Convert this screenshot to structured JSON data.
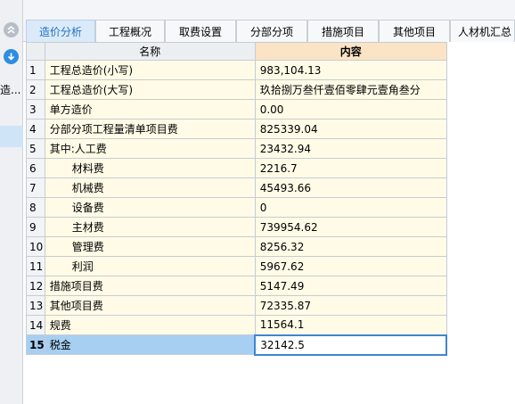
{
  "tabs": [
    {
      "label": "造价分析",
      "active": true
    },
    {
      "label": "工程概况",
      "active": false
    },
    {
      "label": "取费设置",
      "active": false
    },
    {
      "label": "分部分项",
      "active": false
    },
    {
      "label": "措施项目",
      "active": false
    },
    {
      "label": "其他项目",
      "active": false
    },
    {
      "label": "人材机汇总",
      "active": false
    }
  ],
  "rail": {
    "truncated_text": "造..."
  },
  "table": {
    "headers": {
      "name": "名称",
      "content": "内容"
    },
    "rows": [
      {
        "no": "1",
        "name": "工程总造价(小写)",
        "value": "983,104.13"
      },
      {
        "no": "2",
        "name": "工程总造价(大写)",
        "value": "玖拾捌万叁仟壹佰零肆元壹角叁分"
      },
      {
        "no": "3",
        "name": "单方造价",
        "value": "0.00"
      },
      {
        "no": "4",
        "name": "分部分项工程量清单项目费",
        "value": "825339.04"
      },
      {
        "no": "5",
        "name": "其中:人工费",
        "value": "23432.94"
      },
      {
        "no": "6",
        "name": "材料费",
        "value": "2216.7",
        "indent": true
      },
      {
        "no": "7",
        "name": "机械费",
        "value": "45493.66",
        "indent": true
      },
      {
        "no": "8",
        "name": "设备费",
        "value": "0",
        "indent": true
      },
      {
        "no": "9",
        "name": "主材费",
        "value": "739954.62",
        "indent": true
      },
      {
        "no": "10",
        "name": "管理费",
        "value": "8256.32",
        "indent": true
      },
      {
        "no": "11",
        "name": "利润",
        "value": "5967.62",
        "indent": true
      },
      {
        "no": "12",
        "name": "措施项目费",
        "value": "5147.49"
      },
      {
        "no": "13",
        "name": "其他项目费",
        "value": "72335.87"
      },
      {
        "no": "14",
        "name": "规费",
        "value": "11564.1"
      },
      {
        "no": "15",
        "name": "税金",
        "value": "32142.5",
        "selected": true
      }
    ]
  },
  "colors": {
    "active_tab": "#1f6fc4",
    "header_content_bg": "#fbe3c6",
    "cell_bg": "#fffbe7",
    "selected_row": "#a7cff2"
  }
}
